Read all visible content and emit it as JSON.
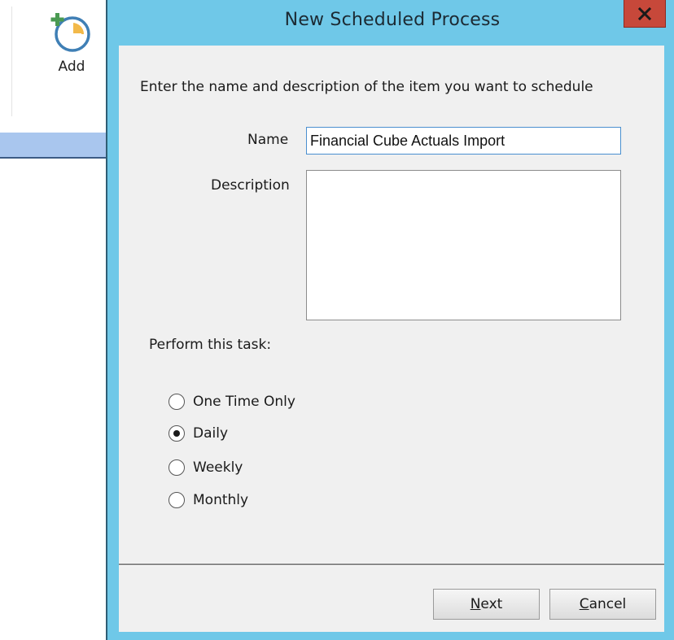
{
  "ribbon": {
    "add_label": "Add"
  },
  "dialog": {
    "title": "New Scheduled Process",
    "close_glyph": "x",
    "instruction": "Enter the name and description of the item you want to schedule",
    "name_label": "Name",
    "name_value": "Financial Cube Actuals Import",
    "description_label": "Description",
    "description_value": "",
    "task_label": "Perform this task:",
    "frequency_options": [
      {
        "label": "One Time Only",
        "checked": false
      },
      {
        "label": "Daily",
        "checked": true
      },
      {
        "label": "Weekly",
        "checked": false
      },
      {
        "label": "Monthly",
        "checked": false
      }
    ],
    "next_button": {
      "mnemonic": "N",
      "rest": "ext"
    },
    "cancel_button": {
      "mnemonic": "C",
      "rest": "ancel"
    }
  },
  "colors": {
    "title_bar": "#6fc8e8",
    "close_button": "#c7483a",
    "client_area": "#f0f0f0",
    "selected_strip": "#a9c6ee",
    "icon_accent_green": "#4a9a52",
    "icon_accent_orange": "#f2b94a",
    "icon_ring_blue": "#3f7fb5"
  },
  "icons": {
    "add_icon": "clock-with-plus-icon",
    "close_icon": "close-x-icon"
  }
}
